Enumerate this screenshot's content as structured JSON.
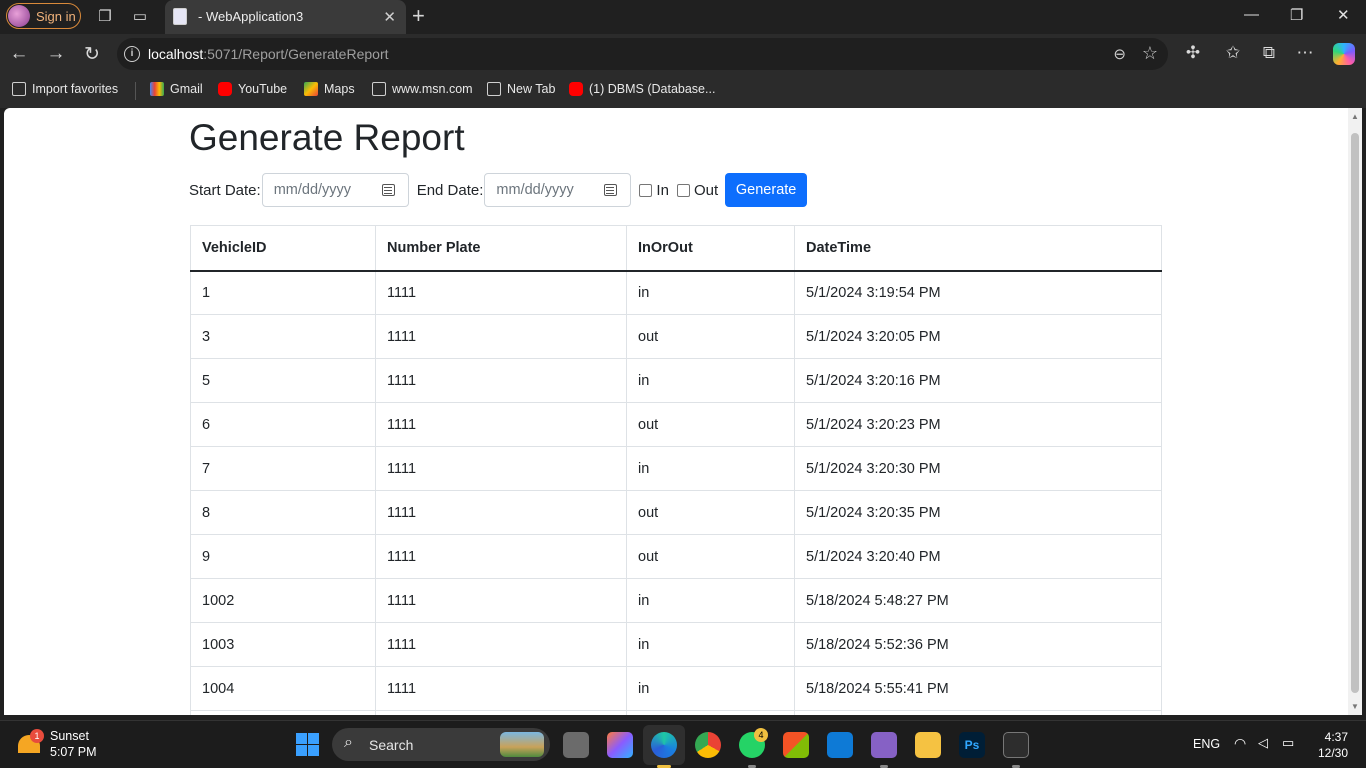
{
  "browser": {
    "sign_in": "Sign in",
    "tab_title": "- WebApplication3",
    "url_host": "localhost",
    "url_rest": ":5071/Report/GenerateReport",
    "favorites": [
      "Import favorites",
      "Gmail",
      "YouTube",
      "Maps",
      "www.msn.com",
      "New Tab",
      "(1) DBMS (Database..."
    ]
  },
  "page": {
    "title": "Generate Report",
    "start_label": "Start Date:",
    "start_placeholder": "mm/dd/yyyy",
    "end_label": "End Date:",
    "end_placeholder": "mm/dd/yyyy",
    "in_label": "In",
    "out_label": "Out",
    "generate_label": "Generate"
  },
  "table": {
    "headers": [
      "VehicleID",
      "Number Plate",
      "InOrOut",
      "DateTime"
    ],
    "rows": [
      [
        "1",
        "1111",
        "in",
        "5/1/2024 3:19:54 PM"
      ],
      [
        "3",
        "1111",
        "out",
        "5/1/2024 3:20:05 PM"
      ],
      [
        "5",
        "1111",
        "in",
        "5/1/2024 3:20:16 PM"
      ],
      [
        "6",
        "1111",
        "out",
        "5/1/2024 3:20:23 PM"
      ],
      [
        "7",
        "1111",
        "in",
        "5/1/2024 3:20:30 PM"
      ],
      [
        "8",
        "1111",
        "out",
        "5/1/2024 3:20:35 PM"
      ],
      [
        "9",
        "1111",
        "out",
        "5/1/2024 3:20:40 PM"
      ],
      [
        "1002",
        "1111",
        "in",
        "5/18/2024 5:48:27 PM"
      ],
      [
        "1003",
        "1111",
        "in",
        "5/18/2024 5:52:36 PM"
      ],
      [
        "1004",
        "1111",
        "in",
        "5/18/2024 5:55:41 PM"
      ]
    ]
  },
  "taskbar": {
    "weather_badge": "1",
    "weather_title": "Sunset",
    "weather_time": "5:07 PM",
    "search_label": "Search",
    "whatsapp_badge": "4",
    "lang": "ENG",
    "time": "4:37",
    "date": "12/30"
  },
  "colors": {
    "accent": "#0d6efd",
    "browser_bg": "#202020"
  }
}
